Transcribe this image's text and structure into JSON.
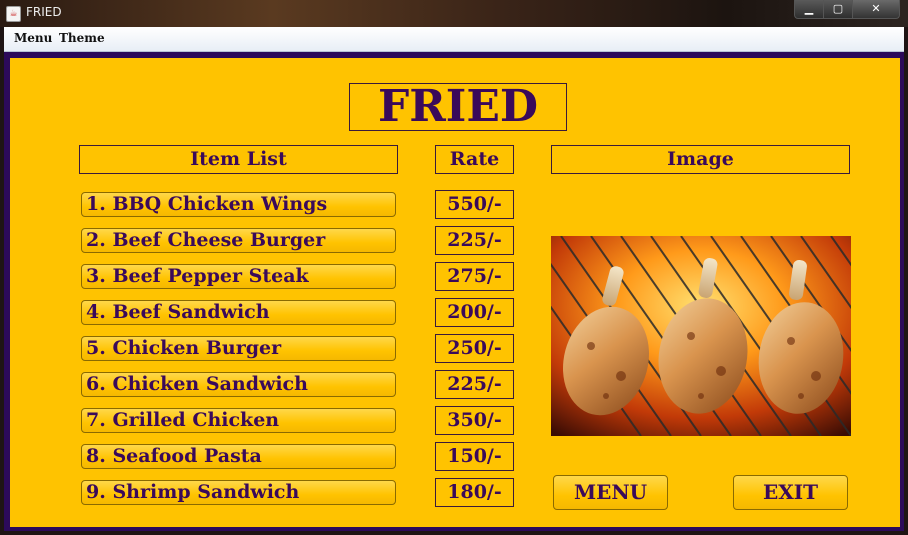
{
  "window": {
    "title": "FRIED",
    "controls": {
      "minimize": "▁",
      "maximize": "▢",
      "close": "✕"
    }
  },
  "menubar": {
    "items": [
      "Menu",
      "Theme"
    ]
  },
  "heading": "FRIED",
  "columns": {
    "items": "Item List",
    "rate": "Rate",
    "image": "Image"
  },
  "items": [
    {
      "label": "1. BBQ Chicken Wings",
      "rate": "550/-"
    },
    {
      "label": "2. Beef Cheese Burger",
      "rate": "225/-"
    },
    {
      "label": "3. Beef Pepper Steak",
      "rate": "275/-"
    },
    {
      "label": "4. Beef Sandwich",
      "rate": "200/-"
    },
    {
      "label": "5. Chicken Burger",
      "rate": "250/-"
    },
    {
      "label": "6. Chicken Sandwich",
      "rate": "225/-"
    },
    {
      "label": "7. Grilled Chicken",
      "rate": "350/-"
    },
    {
      "label": "8. Seafood Pasta",
      "rate": "150/-"
    },
    {
      "label": "9. Shrimp Sandwich",
      "rate": "180/-"
    }
  ],
  "actions": {
    "menu": "MENU",
    "exit": "EXIT"
  },
  "colors": {
    "panel": "#ffc300",
    "frame_border": "#2c0a5a",
    "text": "#3a0a5a"
  }
}
